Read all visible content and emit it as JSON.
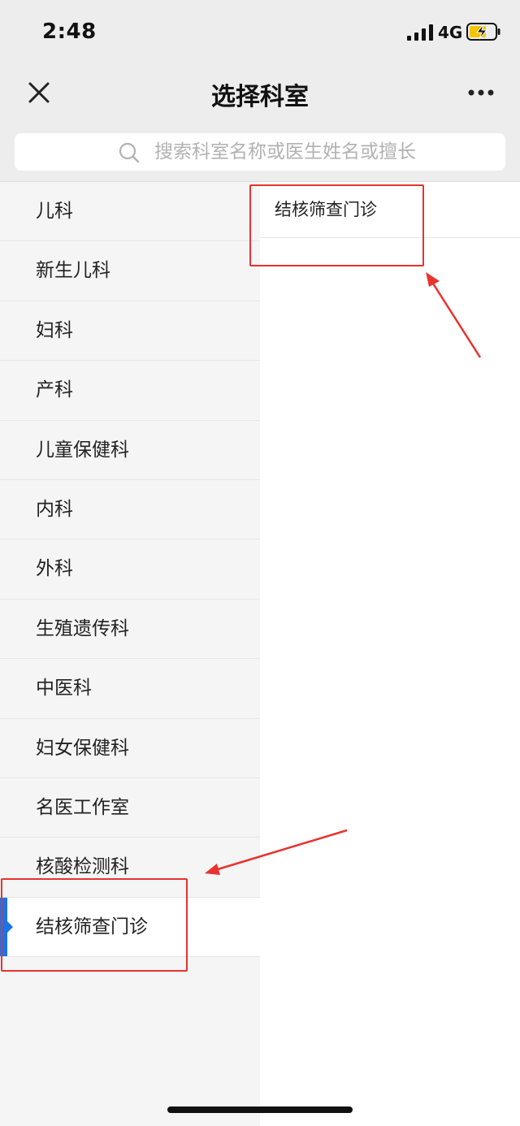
{
  "status_bar": {
    "time": "2:48",
    "network": "4G",
    "icons": [
      "signal-bars-icon",
      "battery-charging-icon"
    ]
  },
  "nav_bar": {
    "title": "选择科室",
    "icons": [
      "close-icon",
      "more-icon"
    ]
  },
  "search": {
    "placeholder": "搜索科室名称或医生姓名或擅长",
    "value": "",
    "icon": "search-icon"
  },
  "departments": [
    {
      "label": "儿科"
    },
    {
      "label": "新生儿科"
    },
    {
      "label": "妇科"
    },
    {
      "label": "产科"
    },
    {
      "label": "儿童保健科"
    },
    {
      "label": "内科"
    },
    {
      "label": "外科"
    },
    {
      "label": "生殖遗传科"
    },
    {
      "label": "中医科"
    },
    {
      "label": "妇女保健科"
    },
    {
      "label": "名医工作室"
    },
    {
      "label": "核酸检测科"
    },
    {
      "label": "结核筛查门诊"
    }
  ],
  "selected_department": "结核筛查门诊",
  "sub_departments": [
    {
      "label": "结核筛查门诊"
    }
  ],
  "colors": {
    "accent": "#1a73e8",
    "annotation": "#e8332f",
    "header_bg": "#ededed",
    "list_bg": "#f5f5f5"
  }
}
